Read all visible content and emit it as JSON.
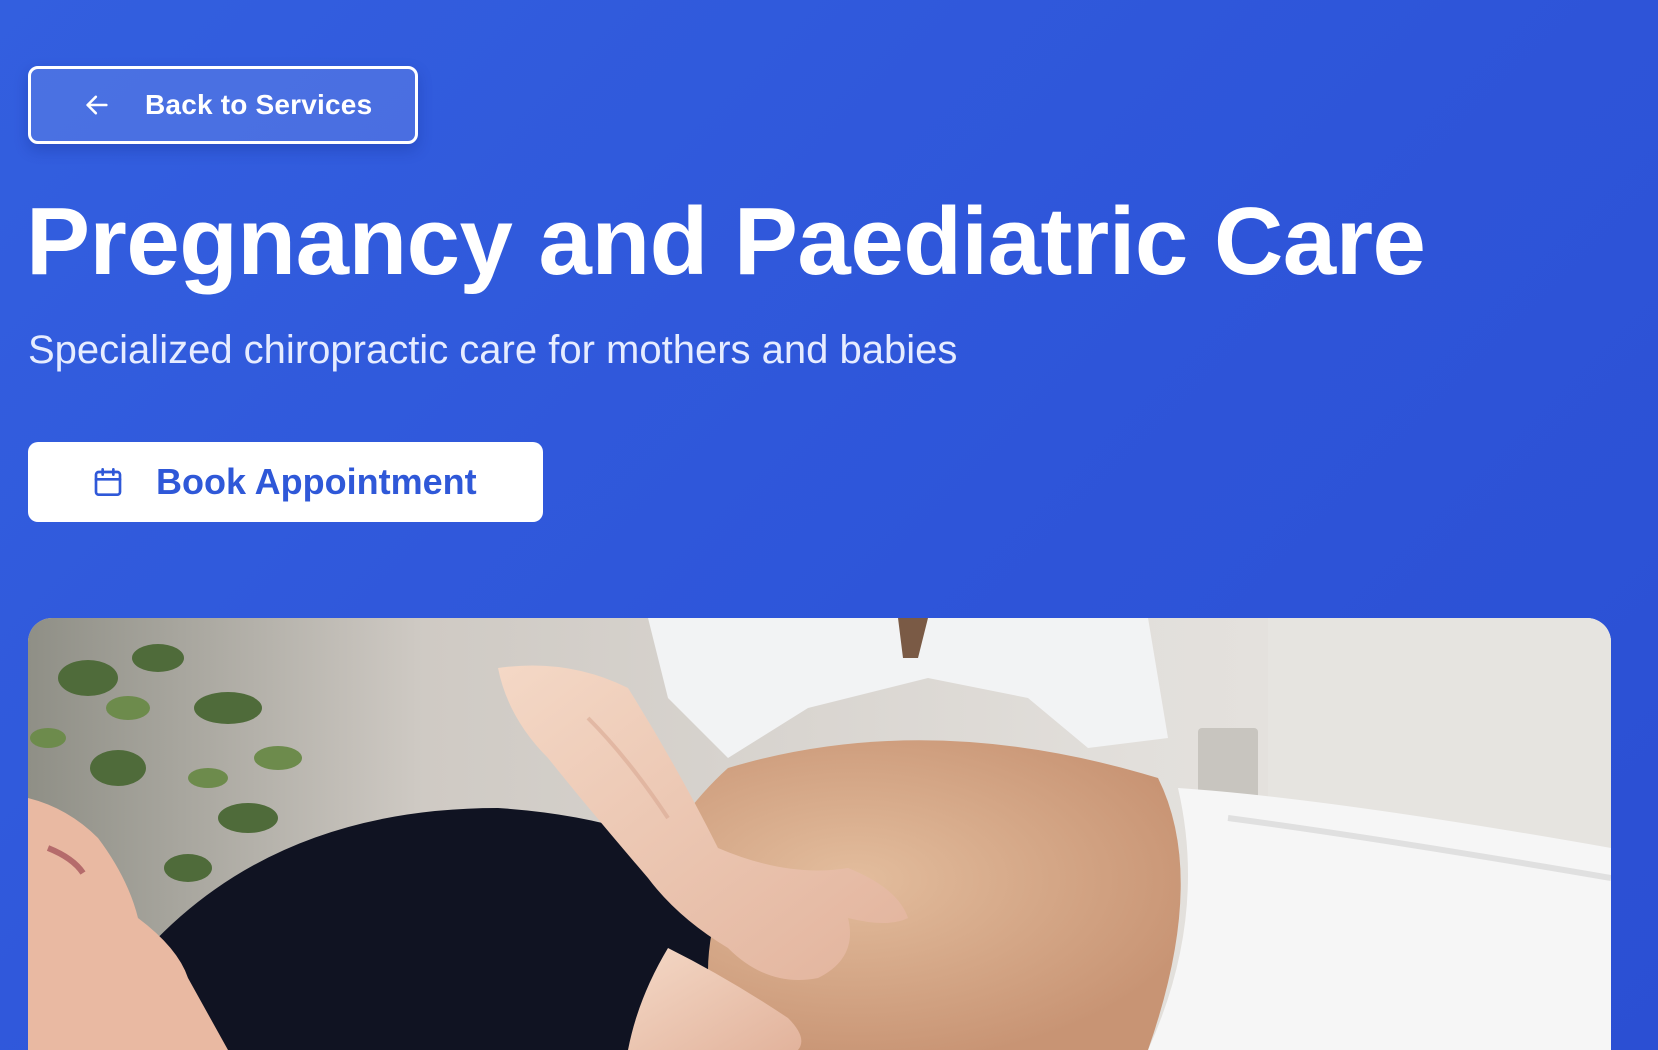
{
  "back_button": {
    "label": "Back to Services",
    "icon": "arrow-left-icon"
  },
  "hero": {
    "title": "Pregnancy and Paediatric Care",
    "subtitle": "Specialized chiropractic care for mothers and babies"
  },
  "book_button": {
    "label": "Book Appointment",
    "icon": "calendar-icon"
  },
  "photo": {
    "subject": "photo of a practitioner's hand on a pregnant woman's belly"
  },
  "colors": {
    "background": "#2f57dc",
    "text": "#ffffff",
    "accent": "#2f58d8"
  }
}
